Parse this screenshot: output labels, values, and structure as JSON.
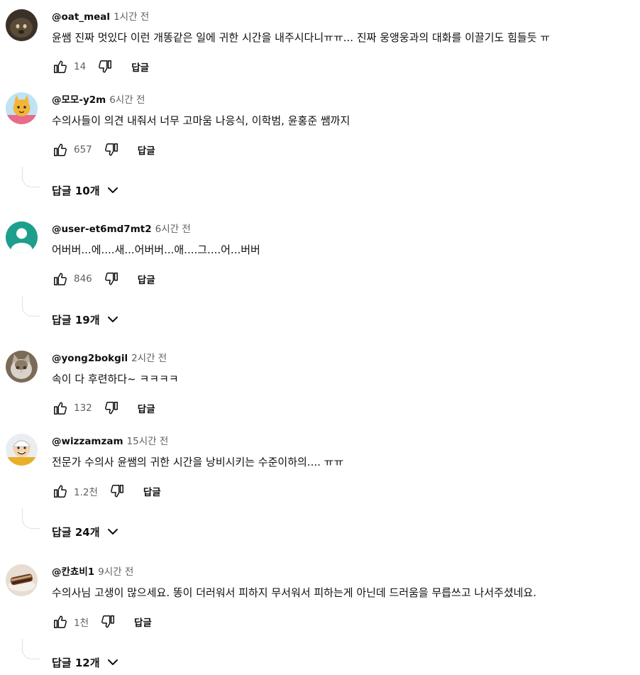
{
  "comments": [
    {
      "author": "@oat_meal",
      "time": "1시간 전",
      "text": "윤쌤 진짜 멋있다 이런 개똥같은 일에 귀한 시간을 내주시다니ㅠㅠ... 진짜 웅앵웅과의 대화를 이끌기도 힘들듯 ㅠ",
      "likes": "14",
      "reply_label": "답글",
      "avatar": "dark-photo",
      "replies": null
    },
    {
      "author": "@모모-y2m",
      "time": "6시간 전",
      "text": "수의사들이 의견 내줘서 너무 고마움 나응식, 이학범, 윤홍준 쌤까지",
      "likes": "657",
      "reply_label": "답글",
      "avatar": "cartoon-character",
      "replies": "답글 10개"
    },
    {
      "author": "@user-et6md7mt2",
      "time": "6시간 전",
      "text": "어버버...에....새...어버버...애....그....어...버버",
      "likes": "846",
      "reply_label": "답글",
      "avatar": "default-teal",
      "replies": "답글 19개"
    },
    {
      "author": "@yong2bokgil",
      "time": "2시간 전",
      "text": "속이 다 후련하다~ ㅋㅋㅋㅋ",
      "likes": "132",
      "reply_label": "답글",
      "avatar": "cat-photo",
      "replies": null
    },
    {
      "author": "@wizzamzam",
      "time": "15시간 전",
      "text": "전문가 수의사 윤쌤의 귀한 시간을 낭비시키는 수준이하의.... ㅠㅠ",
      "likes": "1.2천",
      "reply_label": "답글",
      "avatar": "cartoon-boy",
      "replies": "답글 24개"
    },
    {
      "author": "@칸쵸비1",
      "time": "9시간 전",
      "text": "수의사님 고생이 많으세요. 똥이 더러워서 피하지 무서워서 피하는게 아닌데 드러움을 무릅쓰고 나서주셨네요.",
      "likes": "1천",
      "reply_label": "답글",
      "avatar": "food-photo",
      "replies": "답글 12개"
    }
  ],
  "icons": {
    "like": "thumbs-up-icon",
    "dislike": "thumbs-down-icon",
    "expand": "chevron-down-icon"
  },
  "colors": {
    "text": "#0f0f0f",
    "secondary": "#606060",
    "default_avatar": "#1e9e8c"
  }
}
